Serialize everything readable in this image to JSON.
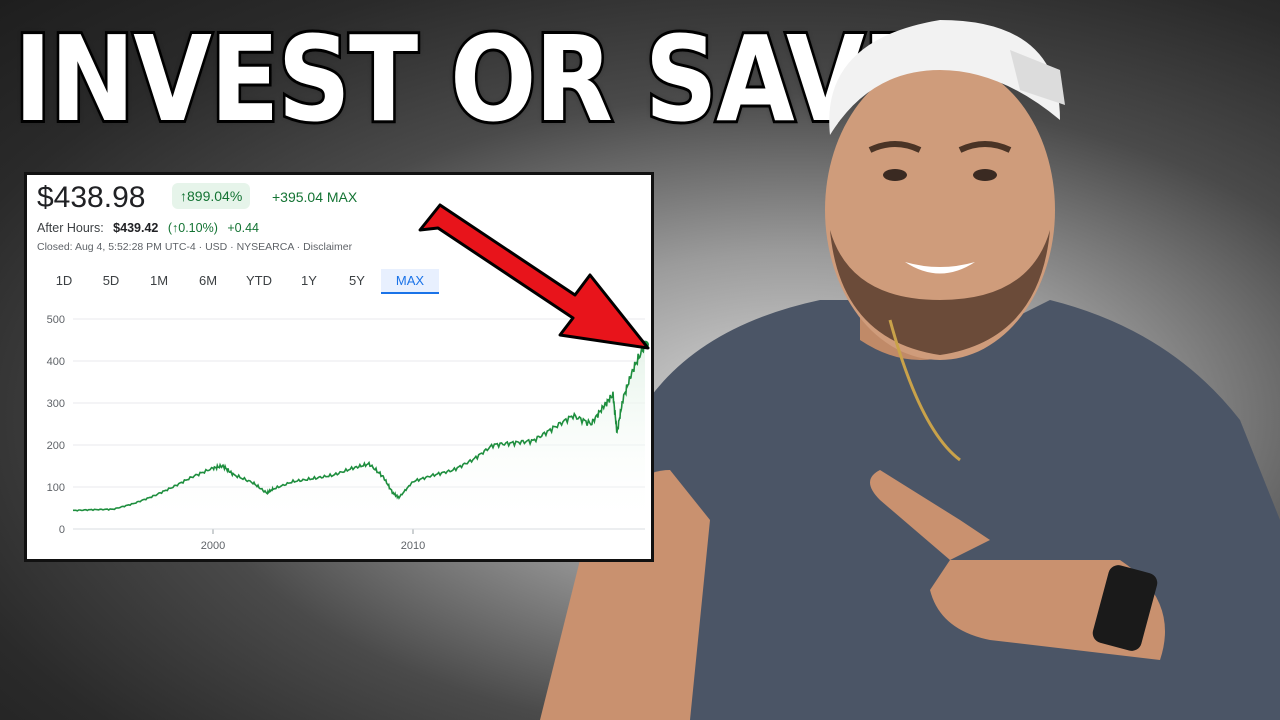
{
  "headline": "INVEST OR SAVE?",
  "quote": {
    "price": "$438.98",
    "pct_change": "↑899.04%",
    "abs_change": "+395.04 MAX",
    "after_hours_label": "After Hours:",
    "after_hours_price": "$439.42",
    "after_hours_pct": "(↑0.10%)",
    "after_hours_delta": "+0.44",
    "closed_text": "Closed: Aug 4, 5:52:28 PM UTC-4 · USD · NYSEARCA · Disclaimer",
    "tabs": [
      "1D",
      "5D",
      "1M",
      "6M",
      "YTD",
      "1Y",
      "5Y",
      "MAX"
    ],
    "active_tab": "MAX"
  },
  "colors": {
    "line": "#1e8e3e",
    "fill": "#e6f4ea",
    "arrow": "#e8141b",
    "card_border": "#111111"
  },
  "chart_data": {
    "type": "area",
    "yticks": [
      "0",
      "100",
      "200",
      "300",
      "400",
      "500"
    ],
    "xticks": [
      "2000",
      "2010"
    ],
    "ylim": [
      0,
      500
    ],
    "xlim": [
      1993,
      2021.6
    ],
    "grid": true,
    "x": [
      1993.0,
      1994.0,
      1995.0,
      1996.0,
      1997.0,
      1998.0,
      1999.0,
      2000.0,
      2000.5,
      2001.0,
      2002.0,
      2002.7,
      2003.0,
      2004.0,
      2005.0,
      2006.0,
      2007.0,
      2007.8,
      2008.5,
      2009.0,
      2009.3,
      2010.0,
      2011.0,
      2012.0,
      2013.0,
      2014.0,
      2015.0,
      2016.0,
      2017.0,
      2018.0,
      2018.9,
      2019.5,
      2020.0,
      2020.2,
      2020.5,
      2021.0,
      2021.6
    ],
    "values": [
      44,
      46,
      47,
      60,
      78,
      100,
      125,
      145,
      150,
      130,
      110,
      85,
      95,
      113,
      120,
      128,
      145,
      155,
      125,
      85,
      75,
      113,
      128,
      140,
      165,
      200,
      205,
      210,
      240,
      270,
      250,
      290,
      320,
      230,
      310,
      380,
      439
    ]
  }
}
